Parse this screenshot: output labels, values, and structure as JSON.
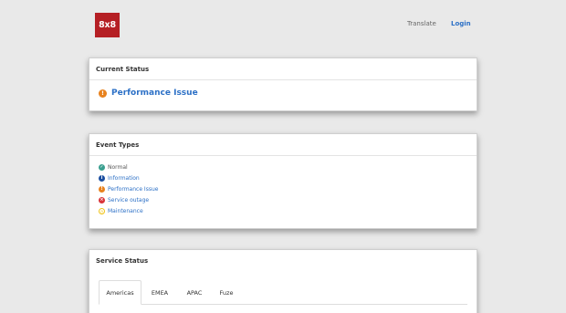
{
  "header": {
    "logo_text": "8x8",
    "translate_label": "Translate",
    "login_label": "Login"
  },
  "current_status": {
    "title": "Current Status",
    "status_text": "Performance Issue",
    "status_color": "#e8821e"
  },
  "event_types": {
    "title": "Event Types",
    "items": [
      {
        "label": "Normal",
        "icon": "check-icon",
        "color": "#3a9f8f"
      },
      {
        "label": "Information",
        "icon": "info-icon",
        "color": "#1b4fa0"
      },
      {
        "label": "Performance Issue",
        "icon": "exclamation-icon",
        "color": "#e8821e"
      },
      {
        "label": "Service outage",
        "icon": "cross-icon",
        "color": "#d9343a"
      },
      {
        "label": "Maintenance",
        "icon": "clock-icon",
        "color": "#f0c419"
      }
    ]
  },
  "service_status": {
    "title": "Service Status",
    "tabs": [
      {
        "label": "Americas",
        "active": true
      },
      {
        "label": "EMEA",
        "active": false
      },
      {
        "label": "APAC",
        "active": false
      },
      {
        "label": "Fuze",
        "active": false
      }
    ]
  },
  "colors": {
    "brand_red": "#b51f24",
    "link_blue": "#2c70c6",
    "background": "#e9e9e9"
  }
}
